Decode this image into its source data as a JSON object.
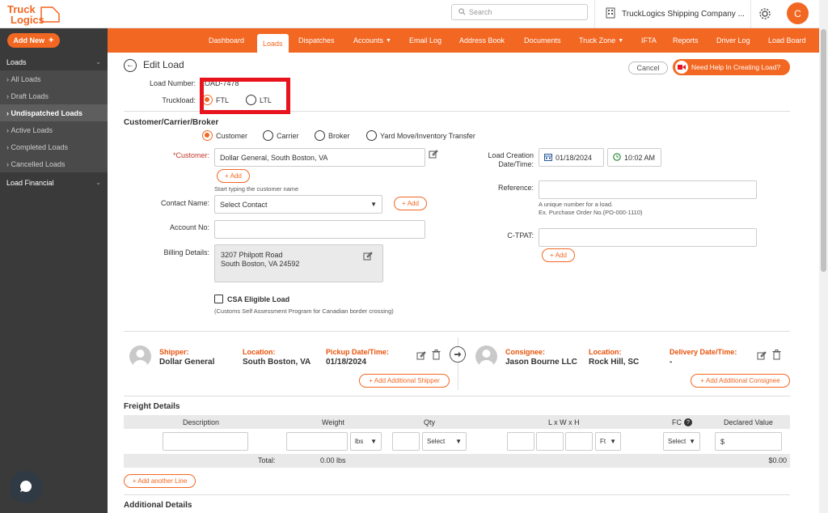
{
  "logo": {
    "line1": "Truck",
    "line2": "Logics"
  },
  "search": {
    "placeholder": "Search"
  },
  "company": {
    "name": "TruckLogics Shipping Company ..."
  },
  "user": {
    "initial": "C"
  },
  "sidebar": {
    "add_new": "Add New",
    "loads_header": "Loads",
    "items": [
      "All Loads",
      "Draft Loads",
      "Undispatched Loads",
      "Active Loads",
      "Completed Loads",
      "Cancelled Loads"
    ],
    "load_financial": "Load Financial"
  },
  "nav": [
    "Dashboard",
    "Loads",
    "Dispatches",
    "Accounts",
    "Email Log",
    "Address Book",
    "Documents",
    "Truck Zone",
    "IFTA",
    "Reports",
    "Driver Log",
    "Load Board"
  ],
  "page": {
    "title": "Edit Load",
    "cancel": "Cancel",
    "help": "Need Help In Creating Load?",
    "load_number_label": "Load Number:",
    "load_number_value": "LOAD-",
    "load_number_tail": "7478",
    "truckload_label": "Truckload:",
    "ftl": "FTL",
    "ltl": "LTL"
  },
  "ccb": {
    "title": "Customer/Carrier/Broker",
    "options": [
      "Customer",
      "Carrier",
      "Broker",
      "Yard Move/Inventory Transfer"
    ],
    "customer_label": "*Customer:",
    "customer_value": "Dollar General, South Boston, VA",
    "add": "Add",
    "start_typing": "Start typing the customer name",
    "contact_label": "Contact Name:",
    "contact_value": "Select Contact",
    "account_label": "Account No:",
    "billing_label": "Billing Details:",
    "billing_line1": "3207 Philpott Road",
    "billing_line2": "South Boston, VA 24592",
    "creation_label_1": "Load Creation",
    "creation_label_2": "Date/Time:",
    "date": "01/18/2024",
    "time": "10:02 AM",
    "reference_label": "Reference:",
    "reference_hint1": "A unique number for a load.",
    "reference_hint2": "Ex. Purchase Order No.(PO-000-1110)",
    "ctpat_label": "C-TPAT:",
    "csa_label": "CSA Eligible Load",
    "csa_hint": "(Customs Self Assessment Program for Canadian border crossing)"
  },
  "shipper": {
    "shipper_label": "Shipper:",
    "shipper_value": "Dollar General",
    "location_label": "Location:",
    "location_value": "South Boston, VA",
    "pickup_label": "Pickup Date/Time:",
    "pickup_value": "01/18/2024",
    "add_shipper": "Add Additional Shipper",
    "consignee_label": "Consignee:",
    "consignee_value": "Jason Bourne LLC",
    "c_location_label": "Location:",
    "c_location_value": "Rock Hill, SC",
    "delivery_label": "Delivery Date/Time:",
    "delivery_value": "-",
    "add_consignee": "Add Additional Consignee"
  },
  "freight": {
    "title": "Freight Details",
    "headers": [
      "Description",
      "Weight",
      "Qty",
      "L x W x H",
      "FC",
      "Declared Value"
    ],
    "weight_unit": "lbs",
    "qty_select": "Select",
    "dim_unit": "Ft",
    "fc_select": "Select",
    "currency": "$",
    "total_label": "Total:",
    "total_weight": "0.00 lbs",
    "total_value": "$0.00",
    "add_line": "Add another Line"
  },
  "additional": {
    "title": "Additional Details"
  }
}
